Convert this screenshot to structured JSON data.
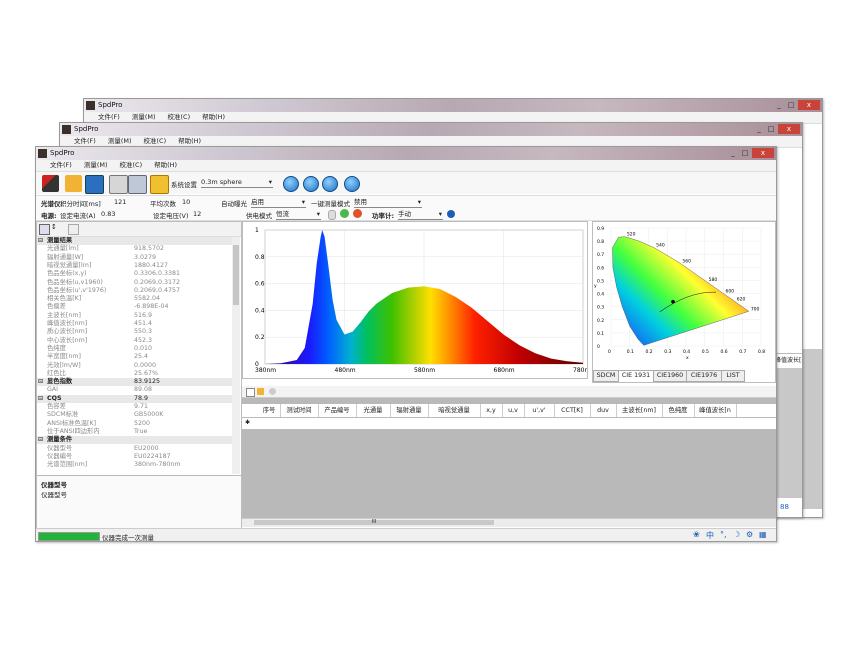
{
  "app": {
    "title": "SpdPro",
    "menu": [
      "文件(F)",
      "测量(M)",
      "校准(C)",
      "帮助(H)"
    ],
    "window_buttons": [
      "_",
      "□",
      "X"
    ]
  },
  "toolbar": {
    "system_settings_label": "系统设置",
    "system_settings_value": "0.3m sphere"
  },
  "params": {
    "spectrometer_label": "光谱仪:",
    "integration_label": "积分时间[ms]",
    "integration_value": "121",
    "avg_label": "平均次数",
    "avg_value": "10",
    "auto_exposure_label": "自动曝光",
    "auto_exposure_value": "启用",
    "onekey_label": "一键测量模式",
    "onekey_value": "禁用",
    "power_label": "电源:",
    "set_current_label": "设定电流(A)",
    "set_current_value": "0.83",
    "set_voltage_label": "设定电压(V)",
    "set_voltage_value": "12",
    "supply_mode_label": "供电模式",
    "supply_mode_value": "恒流",
    "power_meter_label": "功率计:",
    "power_meter_value": "手动"
  },
  "properties": {
    "rows": [
      {
        "k": "测量结果",
        "v": "",
        "cat": true
      },
      {
        "k": "光通量[lm]",
        "v": "918.5702"
      },
      {
        "k": "辐射通量[W]",
        "v": "3.0279"
      },
      {
        "k": "暗视觉通量[lm]",
        "v": "1880.4127"
      },
      {
        "k": "色品坐标(x,y)",
        "v": "0.3306,0.3381"
      },
      {
        "k": "色品坐标(u,v1960)",
        "v": "0.2069,0.3172"
      },
      {
        "k": "色品坐标(u',v'1976)",
        "v": "0.2069,0.4757"
      },
      {
        "k": "相关色温[K]",
        "v": "5582.04"
      },
      {
        "k": "色偏差",
        "v": "-6.898E-04"
      },
      {
        "k": "主波长[nm]",
        "v": "516.9"
      },
      {
        "k": "峰值波长[nm]",
        "v": "451.4"
      },
      {
        "k": "质心波长[nm]",
        "v": "550.3"
      },
      {
        "k": "中心波长[nm]",
        "v": "452.3"
      },
      {
        "k": "色纯度",
        "v": "0.010"
      },
      {
        "k": "半宽度[nm]",
        "v": "25.4"
      },
      {
        "k": "光效[lm/W]",
        "v": "0.0000"
      },
      {
        "k": "红色比",
        "v": "25.67%"
      },
      {
        "k": "显色指数",
        "v": "83.9125",
        "cat": true
      },
      {
        "k": "GAI",
        "v": "89.08"
      },
      {
        "k": "CQS",
        "v": "78.9",
        "cat": true
      },
      {
        "k": "色容差",
        "v": "9.71"
      },
      {
        "k": "SDCM标准",
        "v": "GB5000K"
      },
      {
        "k": "ANSI标准色温[K]",
        "v": "5200"
      },
      {
        "k": "位于ANSI四边形内",
        "v": "True"
      },
      {
        "k": "测量条件",
        "v": "",
        "cat": true
      },
      {
        "k": "仪器型号",
        "v": "EU2000"
      },
      {
        "k": "仪器编号",
        "v": "EU0224187"
      },
      {
        "k": "光谱范围[nm]",
        "v": "380nm-780nm"
      }
    ],
    "desc_title": "仪器型号",
    "desc_text": "仪器型号"
  },
  "chart_data": [
    {
      "type": "area",
      "title": "",
      "xlabel": "",
      "ylabel": "",
      "xlim": [
        380,
        780
      ],
      "ylim": [
        0,
        1
      ],
      "x_ticks": [
        "380nm",
        "480nm",
        "580nm",
        "680nm",
        "780nm"
      ],
      "y_ticks": [
        "0",
        "0.2",
        "0.4",
        "0.6",
        "0.8",
        "1"
      ],
      "x": [
        380,
        400,
        420,
        430,
        440,
        445,
        450,
        452,
        455,
        460,
        465,
        470,
        480,
        490,
        500,
        510,
        520,
        540,
        560,
        580,
        600,
        620,
        640,
        660,
        680,
        700,
        720,
        740,
        760,
        780
      ],
      "values": [
        0,
        0.005,
        0.03,
        0.12,
        0.45,
        0.75,
        0.95,
        1.0,
        0.95,
        0.72,
        0.48,
        0.33,
        0.22,
        0.24,
        0.31,
        0.39,
        0.45,
        0.53,
        0.57,
        0.58,
        0.56,
        0.5,
        0.42,
        0.32,
        0.22,
        0.14,
        0.08,
        0.04,
        0.02,
        0.01
      ]
    },
    {
      "type": "scatter",
      "title": "CIE 1931",
      "xlabel": "x",
      "ylabel": "y",
      "xlim": [
        0,
        0.8
      ],
      "ylim": [
        0,
        0.9
      ],
      "x_ticks": [
        "0",
        "0.1",
        "0.2",
        "0.3",
        "0.4",
        "0.5",
        "0.6",
        "0.7",
        "0.8"
      ],
      "y_ticks": [
        "0",
        "0.1",
        "0.2",
        "0.3",
        "0.4",
        "0.5",
        "0.6",
        "0.7",
        "0.8",
        "0.9"
      ],
      "wavelength_labels": [
        "520",
        "540",
        "560",
        "580",
        "600",
        "620",
        "700"
      ],
      "point": {
        "x": 0.3306,
        "y": 0.3381
      }
    }
  ],
  "cie_tabs": [
    "SDCM",
    "CIE 1931",
    "CIE1960",
    "CIE1976",
    "LIST"
  ],
  "grid": {
    "columns": [
      "序号",
      "测试时间",
      "产品编号",
      "光通量",
      "辐射通量",
      "暗视觉通量",
      "x,y",
      "u,v",
      "u',v'",
      "CCT[K]",
      "duv",
      "主波长[nm]",
      "色纯度",
      "峰值波长[n"
    ],
    "new_row_marker": "✱",
    "scroll_marker": "III"
  },
  "status": {
    "progress": 1.0,
    "text": "仪器完成一次测量",
    "icons": [
      "paw-icon",
      "中",
      "°,",
      "moon-icon",
      "settings-icon",
      "grid-icon"
    ]
  },
  "back_windows": {
    "right_column_header": "峰值波长[n",
    "taskbar_glyphs": [
      "A",
      "88"
    ]
  }
}
